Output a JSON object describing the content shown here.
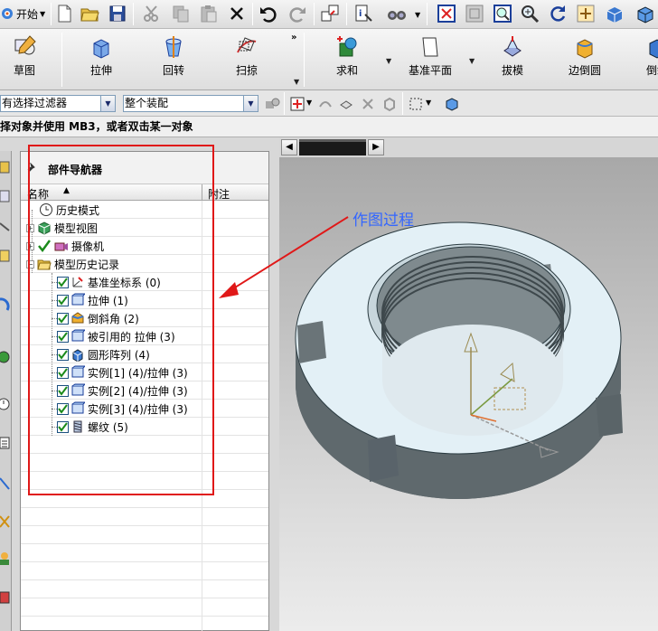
{
  "toolbar": {
    "start_label": "开始",
    "icons": [
      "new-icon",
      "open-icon",
      "save-icon",
      "cut-icon",
      "copy-icon",
      "paste-icon",
      "delete-icon",
      "undo-icon",
      "redo-icon",
      "copy-display-icon",
      "info-icon",
      "binoculars-icon",
      "fit-icon",
      "zoom-window-icon",
      "zoom-box-icon",
      "zoom-icon",
      "rotate-icon",
      "pan-icon",
      "shaded-icon",
      "cube-icon"
    ]
  },
  "ribbon": {
    "items": [
      {
        "label": "草图",
        "icon": "sketch-icon"
      },
      {
        "label": "拉伸",
        "icon": "extrude-icon"
      },
      {
        "label": "回转",
        "icon": "revolve-icon"
      },
      {
        "label": "扫掠",
        "icon": "sweep-icon"
      },
      {
        "label": "求和",
        "icon": "unite-icon"
      },
      {
        "label": "基准平面",
        "icon": "datum-plane-icon"
      },
      {
        "label": "拔模",
        "icon": "draft-icon"
      },
      {
        "label": "边倒圆",
        "icon": "edge-blend-icon"
      },
      {
        "label": "倒斜",
        "icon": "chamfer-icon"
      }
    ]
  },
  "filterbar": {
    "type_filter": "有选择过滤器",
    "scope": "整个装配"
  },
  "status": {
    "hint": "择对象并使用 MB3，或者双击某一对象"
  },
  "navigator": {
    "title": "部件导航器",
    "col_name": "名称",
    "col_note": "附注",
    "nodes": [
      {
        "label": "历史模式"
      },
      {
        "label": "模型视图"
      },
      {
        "label": "摄像机"
      },
      {
        "label": "模型历史记录"
      },
      {
        "label": "基准坐标系 (0)"
      },
      {
        "label": "拉伸 (1)"
      },
      {
        "label": "倒斜角 (2)"
      },
      {
        "label": "被引用的 拉伸 (3)"
      },
      {
        "label": "圆形阵列 (4)"
      },
      {
        "label": "实例[1] (4)/拉伸 (3)"
      },
      {
        "label": "实例[2] (4)/拉伸 (3)"
      },
      {
        "label": "实例[3] (4)/拉伸 (3)"
      },
      {
        "label": "螺纹 (5)"
      }
    ]
  },
  "annotation": {
    "text": "作图过程",
    "color": "#3366ff",
    "box_color": "#e01818"
  },
  "colors": {
    "part_face": "#e3f0f6",
    "part_side": "#5a6468",
    "check": "#1a8a1a"
  }
}
